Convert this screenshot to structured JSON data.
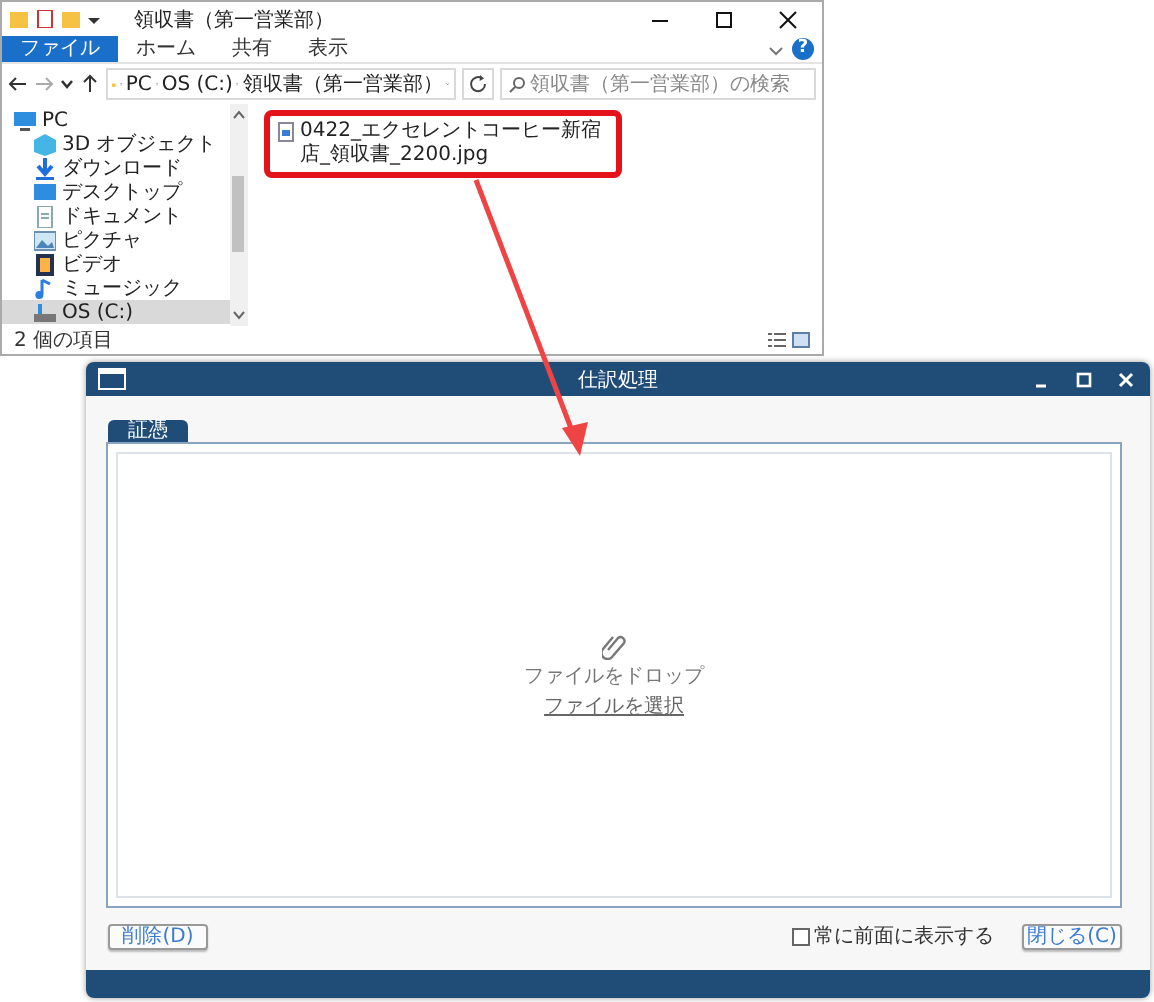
{
  "explorer": {
    "title": "領収書（第一営業部）",
    "ribbon_tabs": [
      {
        "label": "ファイル",
        "selected": true
      },
      {
        "label": "ホーム",
        "selected": false
      },
      {
        "label": "共有",
        "selected": false
      },
      {
        "label": "表示",
        "selected": false
      }
    ],
    "help_button": "?",
    "address_path": [
      "PC",
      "OS (C:)",
      "領収書（第一営業部）"
    ],
    "search": {
      "placeholder": "領収書（第一営業部）の検索"
    },
    "nav_items": [
      {
        "label": "PC",
        "kind": "pc",
        "selected": false,
        "children": [
          {
            "label": "3D オブジェクト",
            "kind": "objects",
            "selected": false
          },
          {
            "label": "ダウンロード",
            "kind": "download",
            "selected": false
          },
          {
            "label": "デスクトップ",
            "kind": "desktop",
            "selected": false
          },
          {
            "label": "ドキュメント",
            "kind": "document",
            "selected": false
          },
          {
            "label": "ピクチャ",
            "kind": "pictures",
            "selected": false
          },
          {
            "label": "ビデオ",
            "kind": "video",
            "selected": false
          },
          {
            "label": "ミュージック",
            "kind": "music",
            "selected": false
          },
          {
            "label": "OS (C:)",
            "kind": "drive",
            "selected": true
          }
        ]
      }
    ],
    "files": [
      {
        "name": "0422_エクセレントコーヒー新宿店_領収書_2200.jpg",
        "highlighted": true
      }
    ],
    "status": "2 個の項目"
  },
  "dialog": {
    "title": "仕訳処理",
    "tabs": [
      {
        "label": "証憑",
        "selected": true
      }
    ],
    "drop_zone": {
      "prompt": "ファイルをドロップ",
      "link": "ファイルを選択"
    },
    "delete_button": "削除(D)",
    "always_on_top": {
      "label": "常に前面に表示する",
      "checked": false
    },
    "close_button": "閉じる(C)"
  }
}
